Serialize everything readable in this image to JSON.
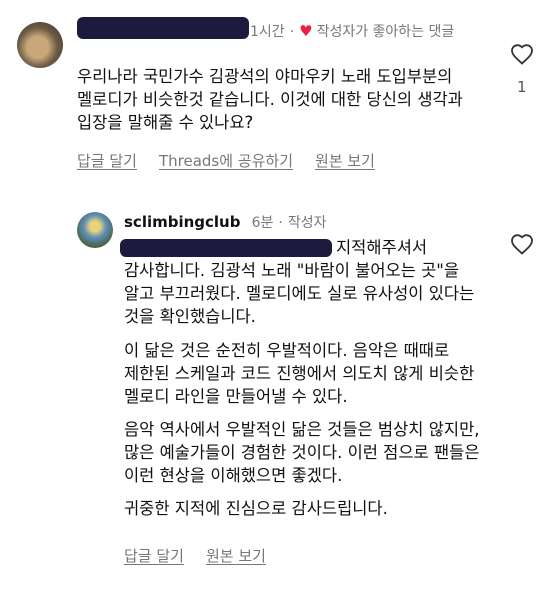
{
  "comment1": {
    "time": "1시간",
    "liked_badge": "작성자가 좋아하는 댓글",
    "text": "우리나라 국민가수 김광석의 야마우키 노래 도입부분의 멜로디가 비슷한것 같습니다. 이것에 대한 당신의 생각과 입장을 말해줄 수 있나요?",
    "actions": [
      "답글 달기",
      "Threads에 공유하기",
      "원본 보기"
    ],
    "like_count": "1",
    "icons": {
      "liked_badge": "heart-icon",
      "like_button": "heart-outline-icon"
    },
    "colors": {
      "heart": "#ee1d42"
    }
  },
  "reply": {
    "username": "sclimbingclub",
    "time": "6분",
    "role": "작성자",
    "paragraphs": [
      "지적해주셔서 감사합니다. 김광석 노래 \"바람이 불어오는 곳\"을 알고 부끄러웠다. 멜로디에도 실로 유사성이 있다는 것을 확인했습니다.",
      "이 닮은 것은 순전히 우발적이다. 음악은 때때로 제한된 스케일과 코드 진행에서 의도치 않게 비슷한 멜로디 라인을 만들어낼 수 있다.",
      "음악 역사에서 우발적인 닮은 것들은 범상치 않지만, 많은 예술가들이 경험한 것이다. 이런 점으로 팬들은 이런 현상을 이해했으면 좋겠다.",
      "귀중한 지적에 진심으로 감사드립니다."
    ],
    "actions": [
      "답글 달기",
      "원본 보기"
    ],
    "icons": {
      "like_button": "heart-outline-icon"
    }
  }
}
